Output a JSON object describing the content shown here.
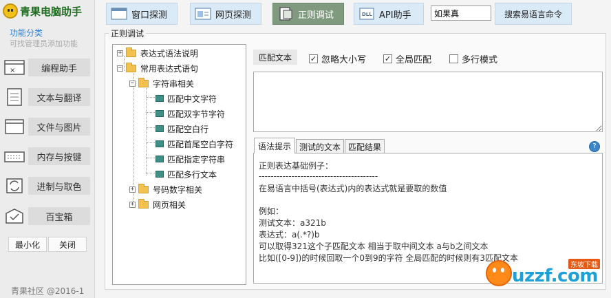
{
  "app": {
    "title": "青果电脑助手"
  },
  "sidebar": {
    "category_title": "功能分类",
    "category_hint": "可找管理员添加功能",
    "items": [
      {
        "label": "编程助手",
        "icon": "terminal-window-icon"
      },
      {
        "label": "文本与翻译",
        "icon": "document-icon"
      },
      {
        "label": "文件与图片",
        "icon": "window-icon"
      },
      {
        "label": "内存与按键",
        "icon": "keyboard-icon"
      },
      {
        "label": "进制与取色",
        "icon": "convert-icon"
      },
      {
        "label": "百宝箱",
        "icon": "toolbox-icon"
      }
    ],
    "minimize_label": "最小化",
    "close_label": "关闭",
    "footer": "青果社区 @2016-1"
  },
  "toolbar": {
    "tabs": [
      {
        "label": "窗口探测",
        "icon": "window-probe-icon",
        "active": false
      },
      {
        "label": "网页探测",
        "icon": "webpage-probe-icon",
        "active": false
      },
      {
        "label": "正则调试",
        "icon": "regex-icon",
        "active": true
      },
      {
        "label": "API助手",
        "icon": "api-icon",
        "active": false
      }
    ],
    "search_value": "如果真",
    "search_button": "搜索易语言命令"
  },
  "main": {
    "group_title": "正则调试",
    "tree": {
      "nodes": [
        {
          "label": "表达式语法说明",
          "type": "folder",
          "expander": "+"
        },
        {
          "label": "常用表达式语句",
          "type": "folder",
          "expander": "−"
        },
        {
          "label": "字符串相关",
          "type": "folder",
          "expander": "−"
        },
        {
          "label": "匹配中文字符",
          "type": "leaf"
        },
        {
          "label": "匹配双字节字符",
          "type": "leaf"
        },
        {
          "label": "匹配空白行",
          "type": "leaf"
        },
        {
          "label": "匹配首尾空白字符",
          "type": "leaf"
        },
        {
          "label": "匹配指定字符串",
          "type": "leaf"
        },
        {
          "label": "匹配多行文本",
          "type": "leaf"
        },
        {
          "label": "号码数字相关",
          "type": "folder",
          "expander": "+"
        },
        {
          "label": "网页相关",
          "type": "folder",
          "expander": "+"
        }
      ]
    },
    "options": {
      "match_text_label": "匹配文本",
      "ignore_case": {
        "label": "忽略大小写",
        "checked": true
      },
      "global_match": {
        "label": "全局匹配",
        "checked": true
      },
      "multiline": {
        "label": "多行模式",
        "checked": false
      }
    },
    "regex_input_value": "",
    "panel_tabs": [
      {
        "label": "语法提示",
        "active": true
      },
      {
        "label": "测试的文本",
        "active": false
      },
      {
        "label": "匹配结果",
        "active": false
      }
    ],
    "panel_lines": [
      "正则表达基础例子：",
      "----------------------------------------",
      "在易语言中括号(表达式)内的表达式就是要取的数值",
      "",
      "例如：",
      "测试文本：a321b",
      "表达式：a(.*?)b",
      "可以取得321这个子匹配文本 相当于取中间文本 a与b之间文本",
      "比如([0-9])的时候回取一个0到9的字符 全局匹配的时候则有3匹配文本"
    ]
  },
  "watermark": {
    "text": "uzzf.com",
    "badge": "东坡下载"
  },
  "colors": {
    "active_tab": "#7f9a7f",
    "tab_bg": "#dbeaf7",
    "brand": "#1f6d1f",
    "accent": "#2b7fd4"
  }
}
